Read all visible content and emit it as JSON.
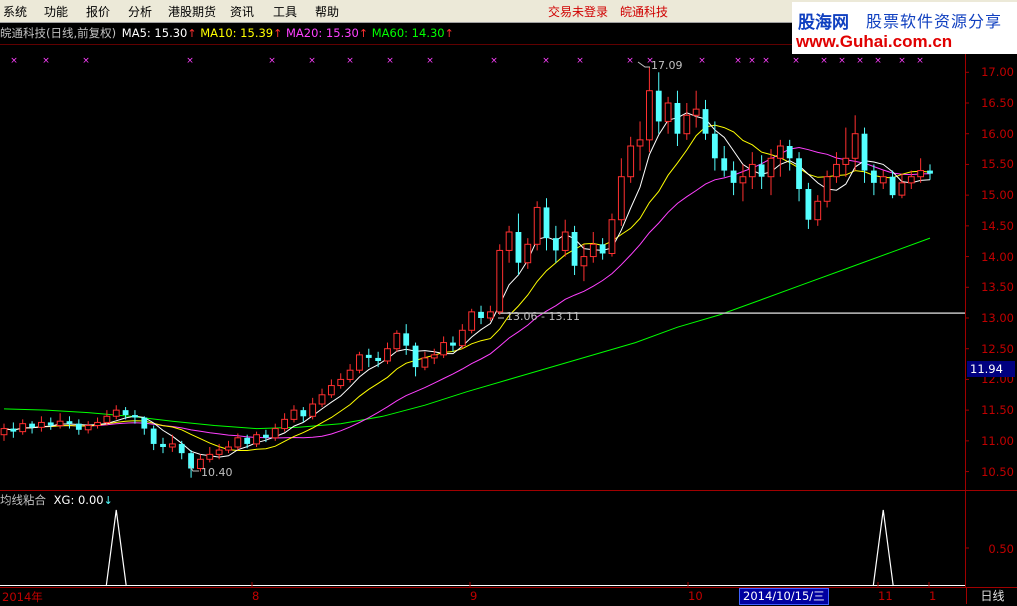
{
  "menu": {
    "items": [
      "系统",
      "功能",
      "报价",
      "分析",
      "港股期货",
      "资讯",
      "工具",
      "帮助"
    ],
    "login_status": "交易未登录",
    "stock_name": "皖通科技"
  },
  "brand": {
    "logo": "股海网",
    "slogan": "股票软件资源分享",
    "url": "www.Guhai.com.cn"
  },
  "main_legend": {
    "title": "皖通科技(日线,前复权)",
    "ma5": "MA5: 15.30",
    "ma10": "MA10: 15.39",
    "ma20": "MA20: 15.30",
    "ma60": "MA60: 14.30",
    "colors": {
      "title": "#c0c0c0",
      "ma5": "#ffffff",
      "ma10": "#ffff00",
      "ma20": "#ff40ff",
      "ma60": "#00ff00"
    }
  },
  "sub_legend": {
    "title": "均线粘合",
    "xg": "XG: 0.00"
  },
  "annotations": {
    "high": "17.09",
    "low": "10.40",
    "range": "13.06 - 13.11"
  },
  "price_axis": {
    "ticks": [
      "17.00",
      "16.50",
      "16.00",
      "15.50",
      "15.00",
      "14.50",
      "14.00",
      "13.50",
      "13.00",
      "12.50",
      "12.00",
      "11.50",
      "11.00",
      "10.50"
    ],
    "current_price": "11.94",
    "sub_tick": "0.50"
  },
  "time_axis": {
    "labels": [
      "2014年",
      "8",
      "9",
      "10",
      "11",
      "1"
    ],
    "cursor_date": "2014/10/15/三",
    "period": "日线"
  },
  "chart_data": {
    "type": "candlestick",
    "ylim": [
      10.2,
      17.2
    ],
    "up_color": "#ff3030",
    "down_color": "#54ffff",
    "candles": [
      [
        11.1,
        11.2,
        11.0,
        11.28
      ],
      [
        11.2,
        11.15,
        11.05,
        11.3
      ],
      [
        11.15,
        11.28,
        11.1,
        11.35
      ],
      [
        11.28,
        11.22,
        11.12,
        11.32
      ],
      [
        11.22,
        11.3,
        11.15,
        11.4
      ],
      [
        11.3,
        11.25,
        11.18,
        11.38
      ],
      [
        11.25,
        11.32,
        11.2,
        11.45
      ],
      [
        11.32,
        11.28,
        11.2,
        11.4
      ],
      [
        11.28,
        11.18,
        11.1,
        11.35
      ],
      [
        11.18,
        11.25,
        11.12,
        11.32
      ],
      [
        11.25,
        11.3,
        11.2,
        11.38
      ],
      [
        11.3,
        11.4,
        11.25,
        11.5
      ],
      [
        11.4,
        11.5,
        11.35,
        11.58
      ],
      [
        11.5,
        11.42,
        11.35,
        11.55
      ],
      [
        11.42,
        11.38,
        11.28,
        11.5
      ],
      [
        11.38,
        11.2,
        11.1,
        11.4
      ],
      [
        11.2,
        10.95,
        10.85,
        11.25
      ],
      [
        10.95,
        10.9,
        10.8,
        11.05
      ],
      [
        10.9,
        10.95,
        10.82,
        11.1
      ],
      [
        10.95,
        10.8,
        10.7,
        11.0
      ],
      [
        10.8,
        10.55,
        10.4,
        10.85
      ],
      [
        10.55,
        10.7,
        10.5,
        10.78
      ],
      [
        10.7,
        10.78,
        10.65,
        10.9
      ],
      [
        10.78,
        10.85,
        10.7,
        10.95
      ],
      [
        10.85,
        10.9,
        10.8,
        11.0
      ],
      [
        10.9,
        11.05,
        10.85,
        11.12
      ],
      [
        11.05,
        10.95,
        10.88,
        11.1
      ],
      [
        10.95,
        11.1,
        10.9,
        11.15
      ],
      [
        11.1,
        11.05,
        10.98,
        11.18
      ],
      [
        11.05,
        11.2,
        11.0,
        11.28
      ],
      [
        11.2,
        11.35,
        11.15,
        11.45
      ],
      [
        11.35,
        11.5,
        11.3,
        11.58
      ],
      [
        11.5,
        11.4,
        11.3,
        11.55
      ],
      [
        11.4,
        11.6,
        11.35,
        11.7
      ],
      [
        11.6,
        11.75,
        11.55,
        11.85
      ],
      [
        11.75,
        11.9,
        11.7,
        12.0
      ],
      [
        11.9,
        12.0,
        11.85,
        12.1
      ],
      [
        12.0,
        12.15,
        11.95,
        12.25
      ],
      [
        12.15,
        12.4,
        12.1,
        12.45
      ],
      [
        12.4,
        12.35,
        12.2,
        12.5
      ],
      [
        12.35,
        12.3,
        12.2,
        12.45
      ],
      [
        12.3,
        12.5,
        12.25,
        12.6
      ],
      [
        12.5,
        12.75,
        12.45,
        12.8
      ],
      [
        12.75,
        12.55,
        12.4,
        12.9
      ],
      [
        12.55,
        12.2,
        12.05,
        12.6
      ],
      [
        12.2,
        12.35,
        12.15,
        12.45
      ],
      [
        12.35,
        12.4,
        12.25,
        12.5
      ],
      [
        12.4,
        12.6,
        12.35,
        12.7
      ],
      [
        12.6,
        12.55,
        12.45,
        12.7
      ],
      [
        12.55,
        12.8,
        12.5,
        12.9
      ],
      [
        12.8,
        13.1,
        12.75,
        13.15
      ],
      [
        13.1,
        13.0,
        12.9,
        13.2
      ],
      [
        13.0,
        13.1,
        12.95,
        13.2
      ],
      [
        13.1,
        14.1,
        13.05,
        14.2
      ],
      [
        14.1,
        14.4,
        13.9,
        14.5
      ],
      [
        14.4,
        13.9,
        13.7,
        14.7
      ],
      [
        13.9,
        14.2,
        13.8,
        14.3
      ],
      [
        14.2,
        14.8,
        14.1,
        14.9
      ],
      [
        14.8,
        14.3,
        14.1,
        14.95
      ],
      [
        14.3,
        14.1,
        13.9,
        14.5
      ],
      [
        14.1,
        14.4,
        14.0,
        14.6
      ],
      [
        14.4,
        13.85,
        13.7,
        14.5
      ],
      [
        13.85,
        14.0,
        13.6,
        14.2
      ],
      [
        14.0,
        14.2,
        13.9,
        14.4
      ],
      [
        14.2,
        14.05,
        13.95,
        14.3
      ],
      [
        14.05,
        14.6,
        14.0,
        14.7
      ],
      [
        14.6,
        15.3,
        14.5,
        15.6
      ],
      [
        15.3,
        15.8,
        15.2,
        15.95
      ],
      [
        15.8,
        15.9,
        15.4,
        16.2
      ],
      [
        15.9,
        16.7,
        15.7,
        17.09
      ],
      [
        16.7,
        16.2,
        16.0,
        17.0
      ],
      [
        16.2,
        16.5,
        16.0,
        16.6
      ],
      [
        16.5,
        16.0,
        15.8,
        16.7
      ],
      [
        16.0,
        16.3,
        15.9,
        16.5
      ],
      [
        16.3,
        16.4,
        16.1,
        16.7
      ],
      [
        16.4,
        16.0,
        15.9,
        16.55
      ],
      [
        16.0,
        15.6,
        15.4,
        16.2
      ],
      [
        15.6,
        15.4,
        15.3,
        15.8
      ],
      [
        15.4,
        15.2,
        15.0,
        15.55
      ],
      [
        15.2,
        15.3,
        14.9,
        15.5
      ],
      [
        15.3,
        15.5,
        15.1,
        15.7
      ],
      [
        15.5,
        15.3,
        15.1,
        15.65
      ],
      [
        15.3,
        15.6,
        15.0,
        15.75
      ],
      [
        15.6,
        15.8,
        15.3,
        15.9
      ],
      [
        15.8,
        15.6,
        15.4,
        15.9
      ],
      [
        15.6,
        15.1,
        14.9,
        15.7
      ],
      [
        15.1,
        14.6,
        14.45,
        15.2
      ],
      [
        14.6,
        14.9,
        14.5,
        15.0
      ],
      [
        14.9,
        15.3,
        14.8,
        15.4
      ],
      [
        15.3,
        15.5,
        15.2,
        15.7
      ],
      [
        15.5,
        15.6,
        15.3,
        16.1
      ],
      [
        15.6,
        16.0,
        15.4,
        16.3
      ],
      [
        16.0,
        15.4,
        15.2,
        16.1
      ],
      [
        15.4,
        15.2,
        15.0,
        15.5
      ],
      [
        15.2,
        15.3,
        15.1,
        15.4
      ],
      [
        15.3,
        15.0,
        14.95,
        15.4
      ],
      [
        15.0,
        15.2,
        14.95,
        15.35
      ],
      [
        15.2,
        15.3,
        15.1,
        15.4
      ],
      [
        15.3,
        15.4,
        15.2,
        15.6
      ],
      [
        15.4,
        15.35,
        15.25,
        15.5
      ]
    ],
    "ma60": [
      11.52,
      11.5,
      11.46,
      11.4,
      11.32,
      11.25,
      11.2,
      11.22,
      11.28,
      11.4,
      11.58,
      11.8,
      12.0,
      12.2,
      12.4,
      12.6,
      12.85,
      13.05,
      13.3,
      13.55,
      13.8,
      14.05,
      14.3
    ],
    "xg_peaks": [
      {
        "index": 12,
        "value": 1.0
      },
      {
        "index": 94,
        "value": 1.0
      }
    ],
    "sub_ylim": [
      0,
      1.0
    ]
  }
}
